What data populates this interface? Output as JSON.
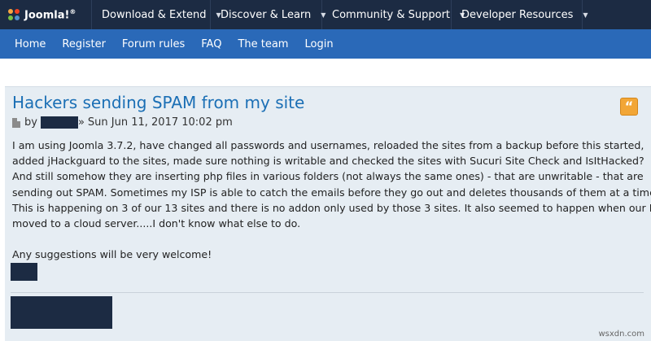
{
  "topnav": {
    "logo_text": "Joomla!",
    "logo_reg": "®",
    "items": [
      {
        "label": "Download & Extend"
      },
      {
        "label": "Discover & Learn"
      },
      {
        "label": "Community & Support"
      },
      {
        "label": "Developer Resources"
      }
    ],
    "caret": "▼"
  },
  "subnav": {
    "items": [
      {
        "label": "Home"
      },
      {
        "label": "Register"
      },
      {
        "label": "Forum rules"
      },
      {
        "label": "FAQ"
      },
      {
        "label": "The team"
      },
      {
        "label": "Login"
      }
    ]
  },
  "post": {
    "title": "Hackers sending SPAM from my site",
    "by": "by",
    "date_sep": "»",
    "date": "Sun Jun 11, 2017 10:02 pm",
    "quote_glyph": "“",
    "lines": [
      "I am using Joomla 3.7.2, have changed all passwords and usernames, reloaded the sites from a backup before this started,",
      "added jHackguard to the sites, made sure nothing is writable and checked the sites with Sucuri Site Check and IsItHacked?",
      "And still somehow they are inserting php files in various folders (not always the same ones) - that are unwritable - that are",
      "sending out SPAM. Sometimes my ISP is able to catch the emails before they go out and deletes thousands of them at a time.",
      "This is happening on 3 of our 13 sites and there is no addon only used by those 3 sites. It also seemed to happen when our ISP",
      "moved to a cloud server.....I don't know what else to do."
    ],
    "closing": "Any suggestions will be very welcome!"
  },
  "watermark": "wsxdn.com",
  "colors": {
    "topbar": "#1c2b43",
    "subnav": "#2a69b8",
    "title": "#1b6fb5",
    "panel": "#e6edf3",
    "quote": "#f2a636"
  }
}
